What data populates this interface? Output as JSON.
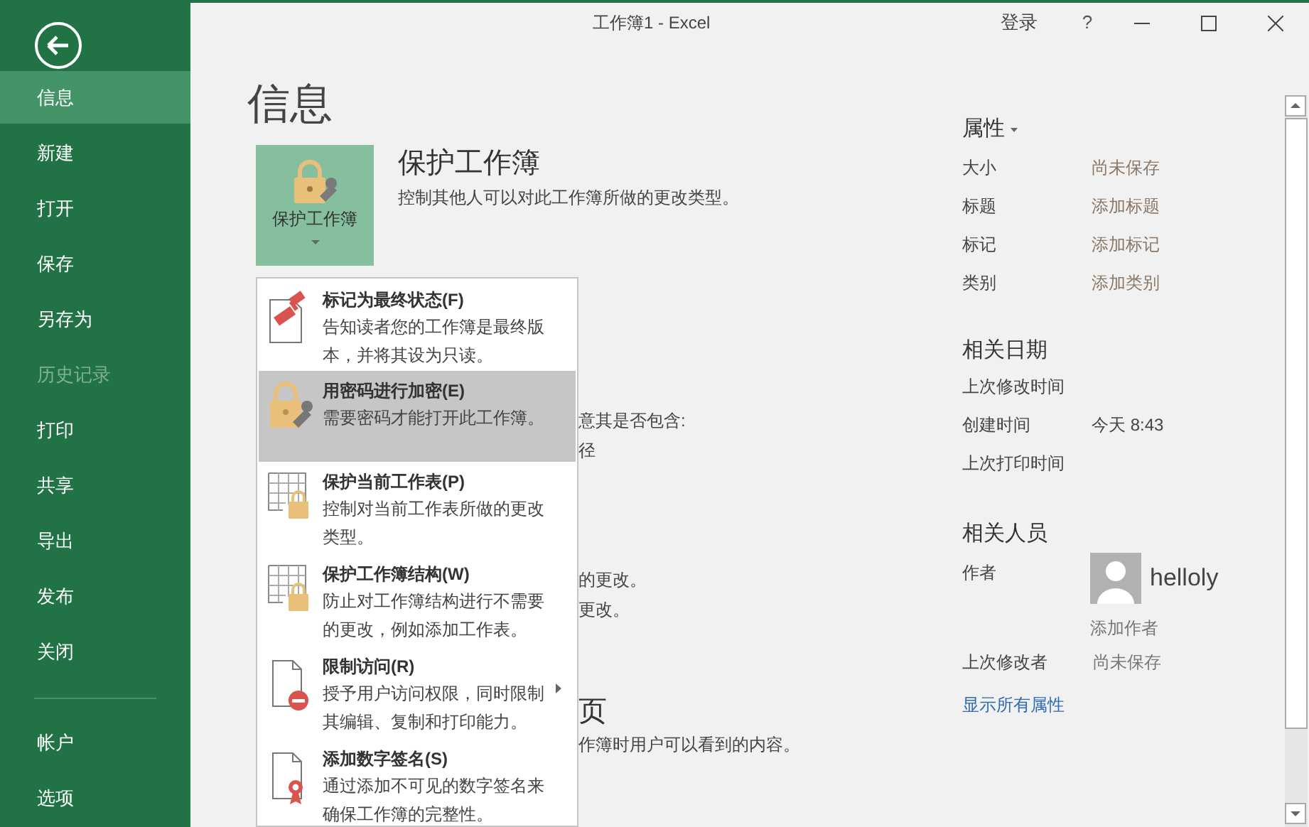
{
  "window": {
    "title": "工作簿1 - Excel",
    "sign_in": "登录",
    "help": "?"
  },
  "sidebar": {
    "items": [
      {
        "label": "信息",
        "selected": true,
        "disabled": false
      },
      {
        "label": "新建",
        "selected": false,
        "disabled": false
      },
      {
        "label": "打开",
        "selected": false,
        "disabled": false
      },
      {
        "label": "保存",
        "selected": false,
        "disabled": false
      },
      {
        "label": "另存为",
        "selected": false,
        "disabled": false
      },
      {
        "label": "历史记录",
        "selected": false,
        "disabled": true
      },
      {
        "label": "打印",
        "selected": false,
        "disabled": false
      },
      {
        "label": "共享",
        "selected": false,
        "disabled": false
      },
      {
        "label": "导出",
        "selected": false,
        "disabled": false
      },
      {
        "label": "发布",
        "selected": false,
        "disabled": false
      },
      {
        "label": "关闭",
        "selected": false,
        "disabled": false
      }
    ],
    "bottom_items": [
      {
        "label": "帐户",
        "selected": false,
        "disabled": false
      },
      {
        "label": "选项",
        "selected": false,
        "disabled": false
      }
    ]
  },
  "page_title": "信息",
  "protect": {
    "button": "保护工作簿",
    "heading": "保护工作簿",
    "description": "控制其他人可以对此工作簿所做的更改类型。"
  },
  "hidden_fragments": [
    {
      "text": "意其是否包含:",
      "kind": "line"
    },
    {
      "text": "径",
      "kind": "line"
    },
    {
      "text": "的更改。",
      "kind": "line"
    },
    {
      "text": "更改。",
      "kind": "line"
    },
    {
      "text": "页",
      "kind": "heading"
    },
    {
      "text": "作簿时用户可以看到的内容。",
      "kind": "line"
    }
  ],
  "menu": {
    "items": [
      {
        "kind": "final",
        "title": "标记为最终状态(**F**)",
        "description": "告知读者您的工作簿是最终版本，并将其设为只读。",
        "selected": false,
        "submenu": false
      },
      {
        "kind": "password",
        "title": "用密码进行加密(**E**)",
        "description": "需要密码才能打开此工作簿。",
        "selected": true,
        "submenu": false
      },
      {
        "kind": "sheet",
        "title": "保护当前工作表(**P**)",
        "description": "控制对当前工作表所做的更改类型。",
        "selected": false,
        "submenu": false
      },
      {
        "kind": "structure",
        "title": "保护工作簿结构(**W**)",
        "description": "防止对工作簿结构进行不需要的更改，例如添加工作表。",
        "selected": false,
        "submenu": false
      },
      {
        "kind": "restrict",
        "title": "限制访问(**R**)",
        "description": "授予用户访问权限，同时限制其编辑、复制和打印能力。",
        "selected": false,
        "submenu": true
      },
      {
        "kind": "signature",
        "title": "添加数字签名(**S**)",
        "description": "通过添加不可见的数字签名来确保工作簿的完整性。",
        "selected": false,
        "submenu": false
      }
    ]
  },
  "properties": {
    "heading": "属性",
    "rows": [
      {
        "label": "大小",
        "value": "尚未保存"
      },
      {
        "label": "标题",
        "value": "添加标题"
      },
      {
        "label": "标记",
        "value": "添加标记"
      },
      {
        "label": "类别",
        "value": "添加类别"
      }
    ]
  },
  "dates": {
    "heading": "相关日期",
    "rows": [
      {
        "label": "上次修改时间"
      },
      {
        "label": "创建时间",
        "value": "今天 8:43"
      },
      {
        "label": "上次打印时间"
      }
    ]
  },
  "people": {
    "heading": "相关人员",
    "author_label": "作者",
    "author": "helloly",
    "add_author": "添加作者",
    "last_modified_label": "上次修改者",
    "last_modified_value": "尚未保存"
  },
  "show_all": "显示所有属性"
}
